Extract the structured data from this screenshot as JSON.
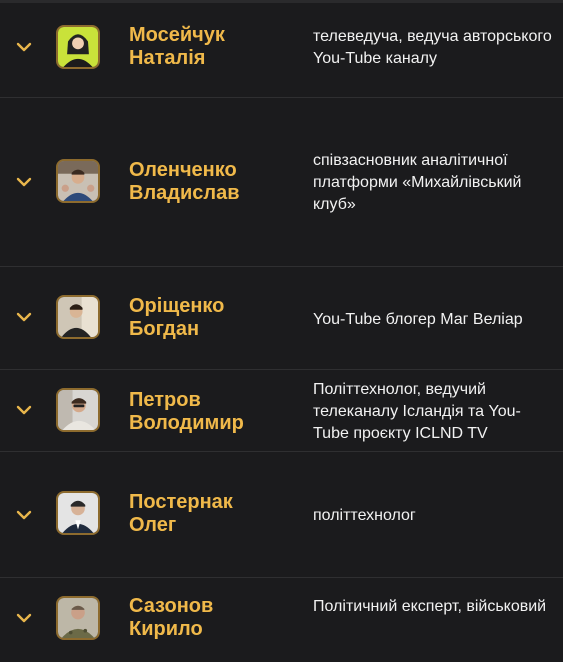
{
  "people": [
    {
      "first_line": "Мосейчук",
      "second_line": "Наталія",
      "description": "телеведуча, ведуча авторського You-Tube каналу",
      "avatar_icon": "person-avatar-icon"
    },
    {
      "first_line": "Оленченко",
      "second_line": "Владислав",
      "description": "співзасновник аналітичної платформи «Михайлівський клуб»",
      "avatar_icon": "person-avatar-icon"
    },
    {
      "first_line": "Оріщенко",
      "second_line": "Богдан",
      "description": "You-Tube блогер Маг Веліар",
      "avatar_icon": "person-avatar-icon"
    },
    {
      "first_line": "Петров",
      "second_line": "Володимир",
      "description": "Політтехнолог, ведучий телеканалу Ісландія та You-Tube проєкту ICLND TV",
      "avatar_icon": "person-avatar-icon"
    },
    {
      "first_line": "Постернак",
      "second_line": "Олег",
      "description": "політтехнолог",
      "avatar_icon": "person-avatar-icon"
    },
    {
      "first_line": "Сазонов",
      "second_line": "Кирило",
      "description": "Політичний експерт, військовий",
      "avatar_icon": "person-avatar-icon"
    }
  ],
  "colors": {
    "background": "#1b1b1d",
    "accent": "#f0b94a",
    "text": "#f2f2f2",
    "divider": "#2f2f31"
  }
}
